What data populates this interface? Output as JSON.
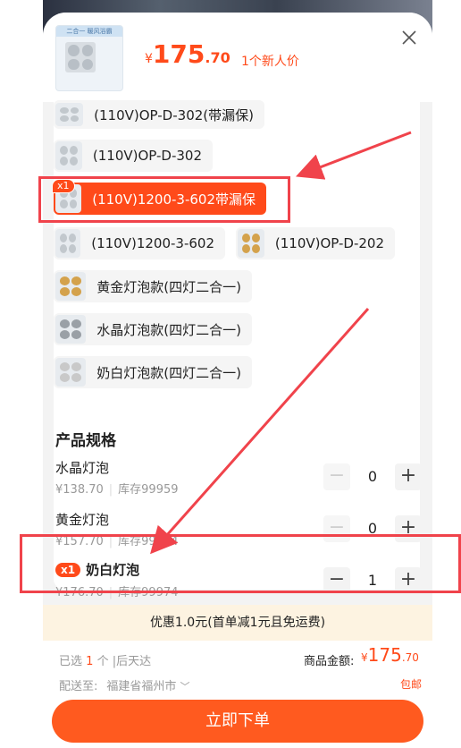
{
  "header": {
    "price_currency": "¥",
    "price_int": "175",
    "price_dec": ".70",
    "new_user_label": "1个新人价",
    "thumb_banner": "二合一 暖风浴霸"
  },
  "variants": [
    {
      "label": "(110V)OP-D-302(带漏保)",
      "selected": false,
      "icon": "lamp-thumb"
    },
    {
      "label": "(110V)OP-D-302",
      "selected": false,
      "icon": "lamp-thumb"
    },
    {
      "label": "(110V)1200-3-602带漏保",
      "selected": true,
      "badge": "x1",
      "icon": "lamp-thumb"
    },
    {
      "label": "(110V)1200-3-602",
      "selected": false,
      "icon": "lamp-thumb"
    },
    {
      "label": "(110V)OP-D-202",
      "selected": false,
      "icon": "lamp-thumb"
    },
    {
      "label": "黄金灯泡款(四灯二合一)",
      "selected": false,
      "icon": "gold-lamp-thumb"
    },
    {
      "label": "水晶灯泡款(四灯二合一)",
      "selected": false,
      "icon": "crystal-lamp-thumb"
    },
    {
      "label": "奶白灯泡款(四灯二合一)",
      "selected": false,
      "icon": "white-lamp-thumb"
    }
  ],
  "specs_title": "产品规格",
  "specs": [
    {
      "name": "水晶灯泡",
      "price": "¥138.70",
      "stock": "库存99959",
      "qty": "0"
    },
    {
      "name": "黄金灯泡",
      "price": "¥157.70",
      "stock": "库存99964",
      "qty": "0"
    },
    {
      "name": "奶白灯泡",
      "price": "¥176.70",
      "stock": "库存99974",
      "qty": "1",
      "badge": "x1"
    }
  ],
  "promo_text": "优惠1.0元(首单减1元且免运费)",
  "footer": {
    "selected_prefix": "已选",
    "selected_count": "1",
    "selected_suffix": "个 |后天达",
    "total_label": "商品金额:",
    "total_currency": "¥",
    "total_int": "175",
    "total_dec": ".70",
    "ship_label": "配送至:",
    "ship_address": "福建省福州市",
    "free_shipping": "包邮",
    "buy_label": "立即下单"
  },
  "colors": {
    "accent": "#ff4a1a",
    "highlight_annotation": "#f0434b",
    "promo_bg": "#fdf3e1"
  }
}
